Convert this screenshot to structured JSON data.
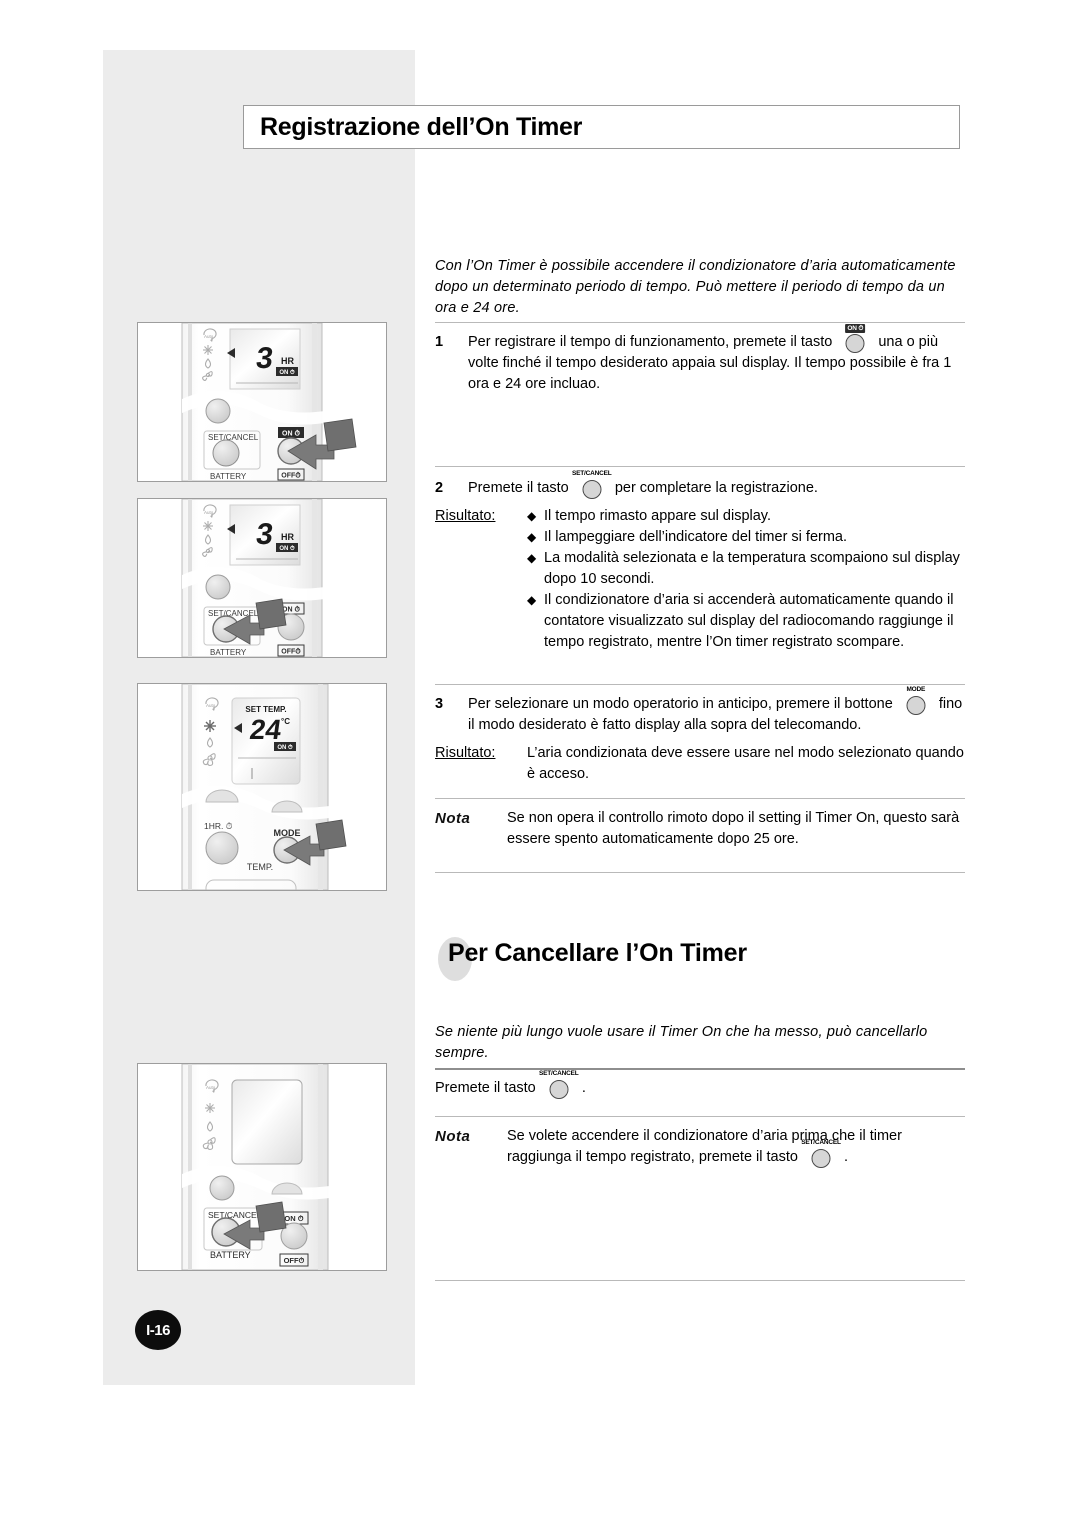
{
  "page": {
    "number_label": "I-16"
  },
  "header": {
    "title": "Registrazione dell’On Timer"
  },
  "section1": {
    "intro": "Con l’On Timer è possibile accendere il condizionatore d’aria automaticamente dopo un determinato periodo di tempo. Può mettere il periodo di tempo da un ora e 24 ore.",
    "steps": [
      {
        "number": "1",
        "text_before": "Per registrare il tempo di funzionamento, premete il tasto",
        "button": {
          "label": "ON ⏱",
          "style": "boxed"
        },
        "text_after": "una o più volte finché il tempo desiderato appaia sul display. Il tempo possibile è fra 1 ora e 24 ore incluao."
      },
      {
        "number": "2",
        "text_before": "Premete il tasto",
        "button": {
          "label": "SET/CANCEL",
          "style": "plain"
        },
        "text_after": "per completare la registrazione.",
        "result_label": "Risultato:",
        "bullets": [
          "Il tempo rimasto appare sul display.",
          "Il lampeggiare dell’indicatore del timer si ferma.",
          "La modalità selezionata e la temperatura scompaiono sul display dopo 10 secondi.",
          "Il condizionatore d’aria si accenderà automaticamente quando il contatore visualizzato sul display del radiocomando raggiunge il tempo registrato, mentre l’On timer registrato scompare."
        ],
        "bullet_marker": "◆"
      },
      {
        "number": "3",
        "text_before": "Per selezionare un modo operatorio in anticipo, premere il bottone",
        "button": {
          "label": "MODE",
          "style": "plain"
        },
        "text_after": "fino il modo desiderato è fatto display alla sopra del telecomando.",
        "result_label": "Risultato:",
        "result_text": "L’aria condizionata deve essere usare nel modo selezionato quando è acceso."
      }
    ],
    "nota": {
      "tag": "Nota",
      "text": "Se non opera il controllo rimoto dopo il setting il Timer On, questo sarà essere spento automaticamente dopo 25 ore."
    }
  },
  "section2": {
    "title": "Per Cancellare l’On Timer",
    "intro": "Se niente più lungo vuole usare il Timer On che ha messo, può cancellarlo sempre.",
    "instruction": {
      "text_before": "Premete il tasto",
      "button": {
        "label": "SET/CANCEL",
        "style": "plain"
      },
      "text_after": "."
    },
    "nota": {
      "tag": "Nota",
      "text_before": "Se volete accendere il condizionatore d’aria prima che il timer raggiunga il tempo registrato, premete il tasto",
      "button": {
        "label": "SET/CANCEL",
        "style": "plain"
      },
      "text_after": "."
    }
  },
  "illustrations": [
    {
      "name": "remote-on-button-press",
      "display_value": "3",
      "display_unit": "HR",
      "display_badge": "ON ⏱",
      "mode_icons": [
        "auto-icon",
        "snowflake-icon",
        "droplet-icon",
        "fan-icon"
      ],
      "buttons": [
        "SET/CANCEL",
        "ON ⏱",
        "OFF ⏱",
        "BATTERY"
      ],
      "pointer_target": "ON"
    },
    {
      "name": "remote-set-cancel-press",
      "display_value": "3",
      "display_unit": "HR",
      "display_badge": "ON ⏱",
      "mode_icons": [
        "auto-icon",
        "snowflake-icon",
        "droplet-icon",
        "fan-icon"
      ],
      "buttons": [
        "SET/CANCEL",
        "ON ⏱",
        "OFF ⏱",
        "BATTERY"
      ],
      "pointer_target": "SET/CANCEL"
    },
    {
      "name": "remote-mode-press",
      "display_caption": "SET TEMP.",
      "display_value": "24",
      "display_unit": "°C",
      "display_badge": "ON ⏱",
      "mode_icons": [
        "auto-icon",
        "snowflake-icon",
        "droplet-icon",
        "fan-icon"
      ],
      "buttons": [
        "1HR. ⏱",
        "MODE",
        "TEMP."
      ],
      "pointer_target": "MODE"
    },
    {
      "name": "remote-cancel-timer",
      "display_value": "",
      "display_unit": "",
      "mode_icons": [
        "auto-icon",
        "snowflake-icon",
        "droplet-icon",
        "fan-icon"
      ],
      "buttons": [
        "SET/CANCEL",
        "ON ⏱",
        "OFF ⏱",
        "BATTERY"
      ],
      "pointer_target": "SET/CANCEL"
    }
  ]
}
